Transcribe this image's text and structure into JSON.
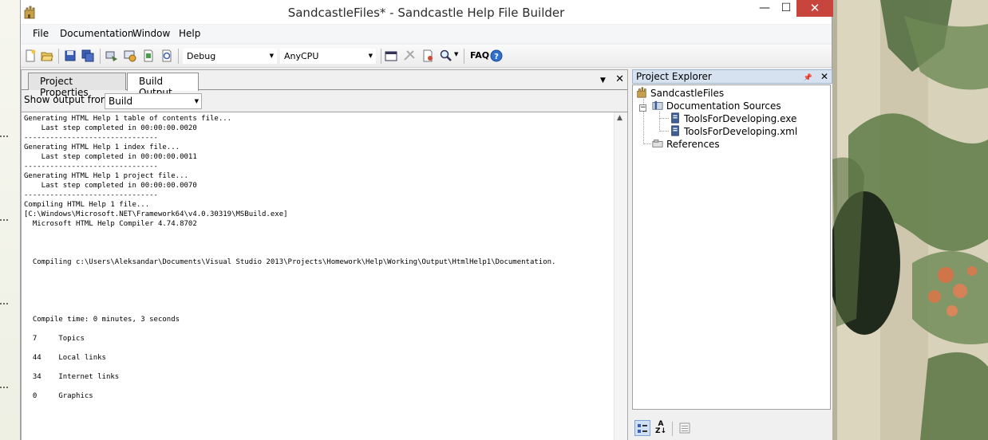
{
  "window": {
    "title": "SandcastleFiles* - Sandcastle Help File Builder",
    "minimize_glyph": "—",
    "maximize_glyph": "☐",
    "close_glyph": "✕"
  },
  "menu": {
    "items": [
      "File",
      "Documentation",
      "Window",
      "Help"
    ]
  },
  "toolbar": {
    "configuration": "Debug",
    "platform": "AnyCPU",
    "faq_label": "FAQ"
  },
  "tabs": [
    {
      "label": "Project Properties",
      "active": false
    },
    {
      "label": "Build Output",
      "active": true
    }
  ],
  "panel": {
    "dropdown_glyph": "▼",
    "close_glyph": "✕",
    "show_output_label": "Show output from",
    "show_output_value": "Build"
  },
  "output": {
    "lines": [
      "Generating HTML Help 1 table of contents file...",
      "    Last step completed in 00:00:00.0020",
      "-------------------------------",
      "Generating HTML Help 1 index file...",
      "    Last step completed in 00:00:00.0011",
      "-------------------------------",
      "Generating HTML Help 1 project file...",
      "    Last step completed in 00:00:00.0070",
      "-------------------------------",
      "Compiling HTML Help 1 file...",
      "[C:\\Windows\\Microsoft.NET\\Framework64\\v4.0.30319\\MSBuild.exe]",
      "  Microsoft HTML Help Compiler 4.74.8702",
      "",
      "",
      "",
      "  Compiling c:\\Users\\Aleksandar\\Documents\\Visual Studio 2013\\Projects\\Homework\\Help\\Working\\Output\\HtmlHelp1\\Documentation.",
      "",
      "",
      "",
      "",
      "",
      "  Compile time: 0 minutes, 3 seconds",
      "",
      "  7     Topics",
      "",
      "  44    Local links",
      "",
      "  34    Internet links",
      "",
      "  0     Graphics"
    ]
  },
  "explorer": {
    "title": "Project Explorer",
    "pin_glyph": "📌",
    "close_glyph": "✕",
    "root": "SandcastleFiles",
    "documentation_sources": "Documentation Sources",
    "files": [
      "ToolsForDeveloping.exe",
      "ToolsForDeveloping.xml"
    ],
    "references": "References",
    "collapse_glyph": "−"
  }
}
